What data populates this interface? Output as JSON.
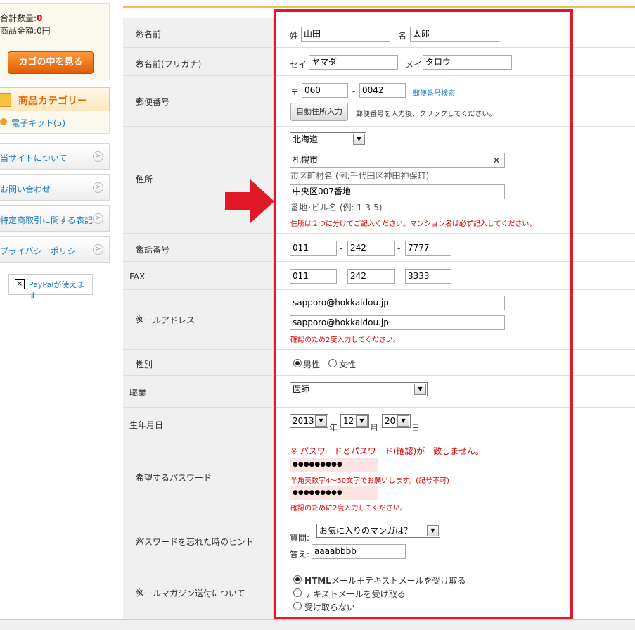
{
  "sidebar": {
    "cart_count_label": "合計数量:",
    "cart_count_value": "0",
    "cart_total_label": "商品金額:",
    "cart_total_value": "0円",
    "cart_button": "カゴの中を見る",
    "category_title": "商品カテゴリー",
    "category_item": "電子キット(5)",
    "nav": [
      "当サイトについて",
      "お問い合わせ",
      "特定商取引に関する表記",
      "プライバシーポリシー"
    ],
    "paypal": "PayPalが使えます"
  },
  "form": {
    "req_mark": "※",
    "name": {
      "label": "お名前",
      "sei_label": "姓",
      "sei": "山田",
      "mei_label": "名",
      "mei": "太郎"
    },
    "kana": {
      "label": "お名前(フリガナ)",
      "sei_label": "セイ",
      "sei": "ヤマダ",
      "mei_label": "メイ",
      "mei": "タロウ"
    },
    "zip": {
      "label": "郵便番号",
      "mark": "〒",
      "zip1": "060",
      "dash": "-",
      "zip2": "0042",
      "search_link": "郵便番号検索",
      "auto_button": "自動住所入力",
      "auto_hint": "郵便番号を入力後、クリックしてください。"
    },
    "address": {
      "label": "住所",
      "pref": "北海道",
      "city": "札幌市",
      "city_hint": "市区町村名 (例:千代田区神田神保町)",
      "street": "中央区007番地",
      "street_hint": "番地･ビル名 (例: 1-3-5)",
      "note": "住所は２つに分けてご記入ください。マンション名は必ず記入してください。"
    },
    "tel": {
      "label": "電話番号",
      "t1": "011",
      "t2": "242",
      "t3": "7777"
    },
    "fax": {
      "label": "FAX",
      "f1": "011",
      "f2": "242",
      "f3": "3333"
    },
    "email": {
      "label": "メールアドレス",
      "email1": "sapporo@hokkaidou.jp",
      "email2": "sapporo@hokkaidou.jp",
      "note": "確認のため2度入力してください。"
    },
    "gender": {
      "label": "性別",
      "male": "男性",
      "female": "女性"
    },
    "job": {
      "label": "職業",
      "value": "医師"
    },
    "birth": {
      "label": "生年月日",
      "year": "2013",
      "year_unit": "年",
      "month": "12",
      "month_unit": "月",
      "day": "20",
      "day_unit": "日"
    },
    "password": {
      "label": "希望するパスワード",
      "error": "※ パスワードとパスワード(確認)が一致しません。",
      "pw1": "●●●●●●●●●",
      "hint": "半角英数字4～50文字でお願いします。(記号不可)",
      "pw2": "●●●●●●●●●",
      "note": "確認のために2度入力してください。"
    },
    "hint": {
      "label": "パスワードを忘れた時のヒント",
      "q_label": "質問:",
      "question": "お気に入りのマンガは？",
      "a_label": "答え:",
      "answer": "aaaabbbb"
    },
    "mailmag": {
      "label": "メールマガジン送付について",
      "opt1_bold": "HTML",
      "opt1_rest": "メール＋テキストメールを受け取る",
      "opt2": "テキストメールを受け取る",
      "opt3": "受け取らない"
    }
  },
  "colors": {
    "highlight_frame": "#e01828",
    "arrow": "#e01828",
    "accent_orange": "#e85d00"
  },
  "icons": [
    "arrow-right-icon",
    "chevron-right-icon",
    "clear-x-icon",
    "dropdown-arrow-icon",
    "paypal-logo-icon"
  ]
}
